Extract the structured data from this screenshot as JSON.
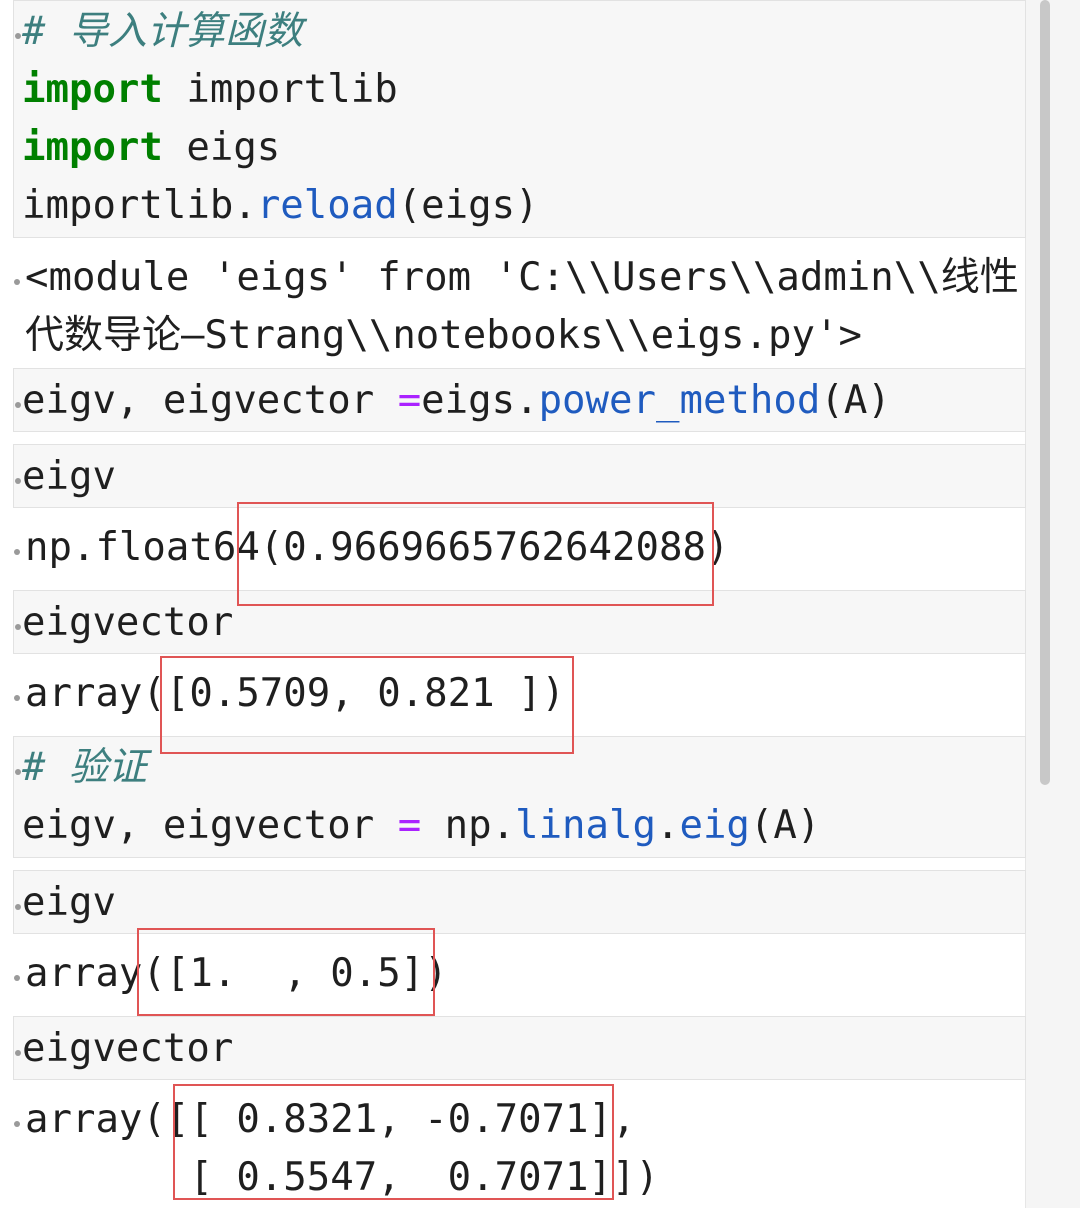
{
  "cells": [
    {
      "id": "c1",
      "kind": "input",
      "lines": [
        [
          {
            "t": "# ",
            "c": "cm"
          },
          {
            "t": "导入计算函数",
            "c": "cm cjk"
          }
        ],
        [
          {
            "t": "import",
            "c": "kw"
          },
          {
            "t": " importlib"
          }
        ],
        [
          {
            "t": "import",
            "c": "kw"
          },
          {
            "t": " eigs"
          }
        ],
        [
          {
            "t": "importlib."
          },
          {
            "t": "reload",
            "c": "fn"
          },
          {
            "t": "(eigs)"
          }
        ]
      ]
    },
    {
      "id": "o1",
      "kind": "output",
      "lines": [
        [
          {
            "t": "<module 'eigs' from 'C:\\\\Users\\\\admin\\\\线性"
          }
        ],
        [
          {
            "t": "代数导论—Strang\\\\notebooks\\\\eigs.py'>"
          }
        ]
      ]
    },
    {
      "id": "c2",
      "kind": "input",
      "lines": [
        [
          {
            "t": "eigv, eigvector "
          },
          {
            "t": "=",
            "c": "op"
          },
          {
            "t": "eigs."
          },
          {
            "t": "power_method",
            "c": "fn"
          },
          {
            "t": "(A)"
          }
        ]
      ]
    },
    {
      "id": "c3",
      "kind": "input",
      "lines": [
        [
          {
            "t": "eigv"
          }
        ]
      ]
    },
    {
      "id": "o3",
      "kind": "output",
      "lines": [
        [
          {
            "t": "np.float64(0.9669665762642088)"
          }
        ]
      ]
    },
    {
      "id": "c4",
      "kind": "input",
      "lines": [
        [
          {
            "t": "eigvector"
          }
        ]
      ]
    },
    {
      "id": "o4",
      "kind": "output",
      "lines": [
        [
          {
            "t": "array([0.5709, 0.821 ])"
          }
        ]
      ]
    },
    {
      "id": "c5",
      "kind": "input",
      "lines": [
        [
          {
            "t": "# ",
            "c": "cm"
          },
          {
            "t": "验证",
            "c": "cm cjk"
          }
        ],
        [
          {
            "t": "eigv, eigvector "
          },
          {
            "t": "=",
            "c": "op"
          },
          {
            "t": " np."
          },
          {
            "t": "linalg",
            "c": "fn"
          },
          {
            "t": "."
          },
          {
            "t": "eig",
            "c": "fn"
          },
          {
            "t": "(A)"
          }
        ]
      ]
    },
    {
      "id": "c6",
      "kind": "input",
      "lines": [
        [
          {
            "t": "eigv"
          }
        ]
      ]
    },
    {
      "id": "o6",
      "kind": "output",
      "lines": [
        [
          {
            "t": "array([1.  , 0.5])"
          }
        ]
      ]
    },
    {
      "id": "c7",
      "kind": "input",
      "lines": [
        [
          {
            "t": "eigvector"
          }
        ]
      ]
    },
    {
      "id": "o7",
      "kind": "output",
      "lines": [
        [
          {
            "t": "array([[ 0.8321, -0.7071],"
          }
        ],
        [
          {
            "t": "       [ 0.5547,  0.7071]])"
          }
        ]
      ]
    }
  ],
  "colors": {
    "keyword": "#008000",
    "function": "#1f5bbf",
    "operator": "#aa22ff",
    "comment": "#3d7f7f",
    "highlight_box": "#e05555"
  }
}
